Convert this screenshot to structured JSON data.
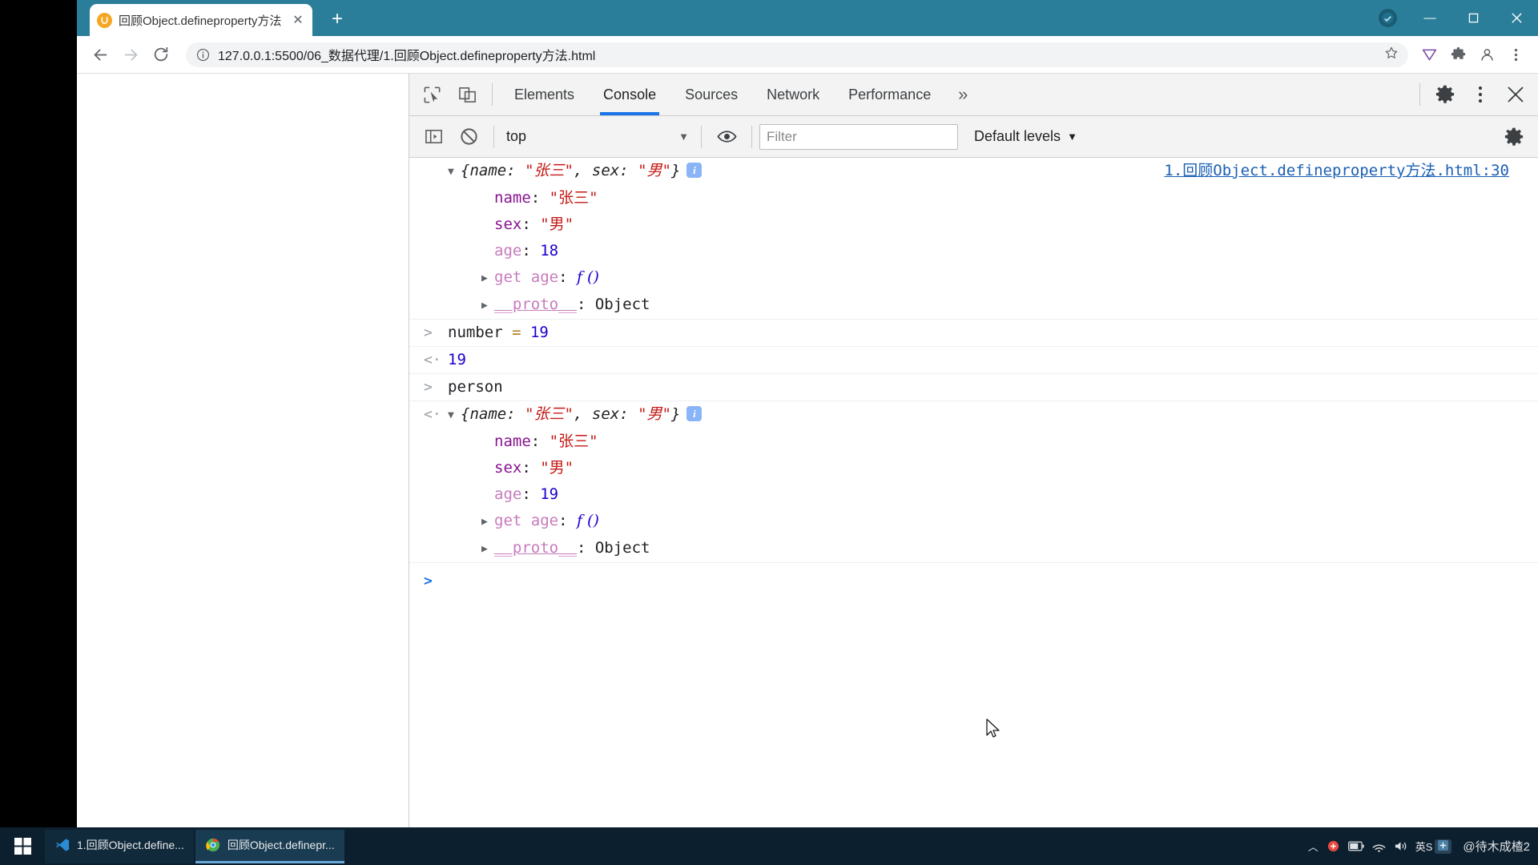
{
  "browser": {
    "tab": {
      "title": "回顾Object.defineproperty方法",
      "close_label": "✕",
      "favicon_name": "site-favicon"
    },
    "newtab_label": "+",
    "window_controls": {
      "minimize": "—",
      "maximize": "▢",
      "close": "✕"
    },
    "omnibox": {
      "url": "127.0.0.1:5500/06_数据代理/1.回顾Object.defineproperty方法.html",
      "info_icon": "ⓘ",
      "star_icon": "☆"
    },
    "toolbar_icons": [
      "back-arrow",
      "forward-arrow",
      "reload",
      "extension-v",
      "puzzle",
      "profile",
      "kebab-menu"
    ]
  },
  "devtools": {
    "tabs": [
      {
        "label": "Elements",
        "active": false
      },
      {
        "label": "Console",
        "active": true
      },
      {
        "label": "Sources",
        "active": false
      },
      {
        "label": "Network",
        "active": false
      },
      {
        "label": "Performance",
        "active": false
      }
    ],
    "more_tabs_label": "»",
    "settings_icon": "gear-icon",
    "kebab_icon": "more-vertical-icon",
    "close_icon": "close-icon",
    "filterbar": {
      "context": "top",
      "context_caret": "▼",
      "filter_placeholder": "Filter",
      "filter_value": "",
      "levels_label": "Default levels",
      "levels_caret": "▼",
      "eye_icon": "eye-icon",
      "clear_icon": "clear-console-icon",
      "sidebar_icon": "console-sidebar-icon"
    },
    "console": {
      "entries": [
        {
          "kind": "output",
          "gutter": "",
          "preview": {
            "open": "{",
            "k1": "name",
            "sep1": ": ",
            "v1": "\"张三\"",
            "comma": ", ",
            "k2": "sex",
            "sep2": ": ",
            "v2": "\"男\"",
            "close": "}"
          },
          "badge": "i",
          "source": "1.回顾Object.defineproperty方法.html:30",
          "props": [
            {
              "key": "name",
              "value": "\"张三\"",
              "type": "string",
              "arrow": false
            },
            {
              "key": "sex",
              "value": "\"男\"",
              "type": "string",
              "arrow": false
            },
            {
              "key": "age",
              "value": "18",
              "type": "number",
              "arrow": false
            },
            {
              "key": "get age",
              "value": "f ()",
              "type": "function",
              "arrow": true
            },
            {
              "key": "__proto__",
              "value": "Object",
              "type": "proto",
              "arrow": true
            }
          ]
        },
        {
          "kind": "input",
          "gutter": ">",
          "text_pre": "number ",
          "text_op": "= ",
          "text_num": "19"
        },
        {
          "kind": "result",
          "gutter": "<·",
          "text_num": "19"
        },
        {
          "kind": "input",
          "gutter": ">",
          "text_pre": "person",
          "text_op": "",
          "text_num": ""
        },
        {
          "kind": "result",
          "gutter": "<·",
          "preview": {
            "open": "{",
            "k1": "name",
            "sep1": ": ",
            "v1": "\"张三\"",
            "comma": ", ",
            "k2": "sex",
            "sep2": ": ",
            "v2": "\"男\"",
            "close": "}"
          },
          "badge": "i",
          "props": [
            {
              "key": "name",
              "value": "\"张三\"",
              "type": "string",
              "arrow": false
            },
            {
              "key": "sex",
              "value": "\"男\"",
              "type": "string",
              "arrow": false
            },
            {
              "key": "age",
              "value": "19",
              "type": "number",
              "arrow": false
            },
            {
              "key": "get age",
              "value": "f ()",
              "type": "function",
              "arrow": true
            },
            {
              "key": "__proto__",
              "value": "Object",
              "type": "proto",
              "arrow": true
            }
          ]
        }
      ],
      "prompt_symbol": ">"
    }
  },
  "taskbar": {
    "start_label": "start",
    "tasks": [
      {
        "label": "1.回顾Object.define...",
        "icon": "vscode-icon",
        "active": false
      },
      {
        "label": "回顾Object.definepr...",
        "icon": "chrome-icon",
        "active": true
      }
    ],
    "tray": {
      "chevron": "︿",
      "ime_text": "英S",
      "watermark": "@待木成楂2"
    }
  },
  "colors": {
    "accent_blue": "#1a73e8",
    "tabstrip_bg": "#2b7e99",
    "string_red": "#c41a16",
    "number_blue": "#1c00cf",
    "key_purple": "#881391",
    "proto_pink": "#c77bbd",
    "link_blue": "#1a5fb4",
    "taskbar_bg": "#0c1f2e"
  }
}
